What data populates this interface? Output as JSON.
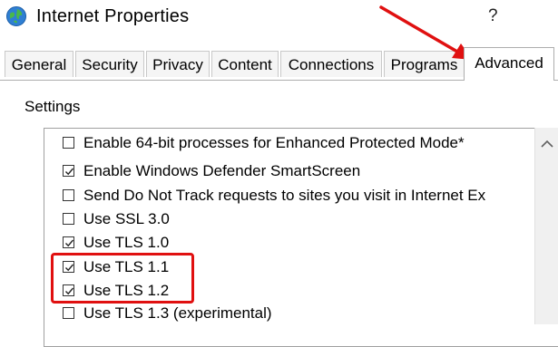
{
  "window": {
    "title": "Internet Properties",
    "help_label": "?"
  },
  "tabs": [
    {
      "label": "General"
    },
    {
      "label": "Security"
    },
    {
      "label": "Privacy"
    },
    {
      "label": "Content"
    },
    {
      "label": "Connections"
    },
    {
      "label": "Programs"
    },
    {
      "label": "Advanced",
      "active": true
    }
  ],
  "settings": {
    "label": "Settings",
    "items": [
      {
        "label": "Enable 64-bit processes for Enhanced Protected Mode*",
        "checked": false
      },
      {
        "label": "Enable Windows Defender SmartScreen",
        "checked": true
      },
      {
        "label": "Send Do Not Track requests to sites you visit in Internet Ex",
        "checked": false
      },
      {
        "label": "Use SSL 3.0",
        "checked": false
      },
      {
        "label": "Use TLS 1.0",
        "checked": true
      },
      {
        "label": "Use TLS 1.1",
        "checked": true
      },
      {
        "label": "Use TLS 1.2",
        "checked": true
      },
      {
        "label": "Use TLS 1.3 (experimental)",
        "checked": false
      }
    ]
  },
  "annotations": {
    "color": "#e01010"
  },
  "icons": {
    "app": "internet-globe-icon",
    "scroll_up": "scroll-up-arrow-icon"
  }
}
